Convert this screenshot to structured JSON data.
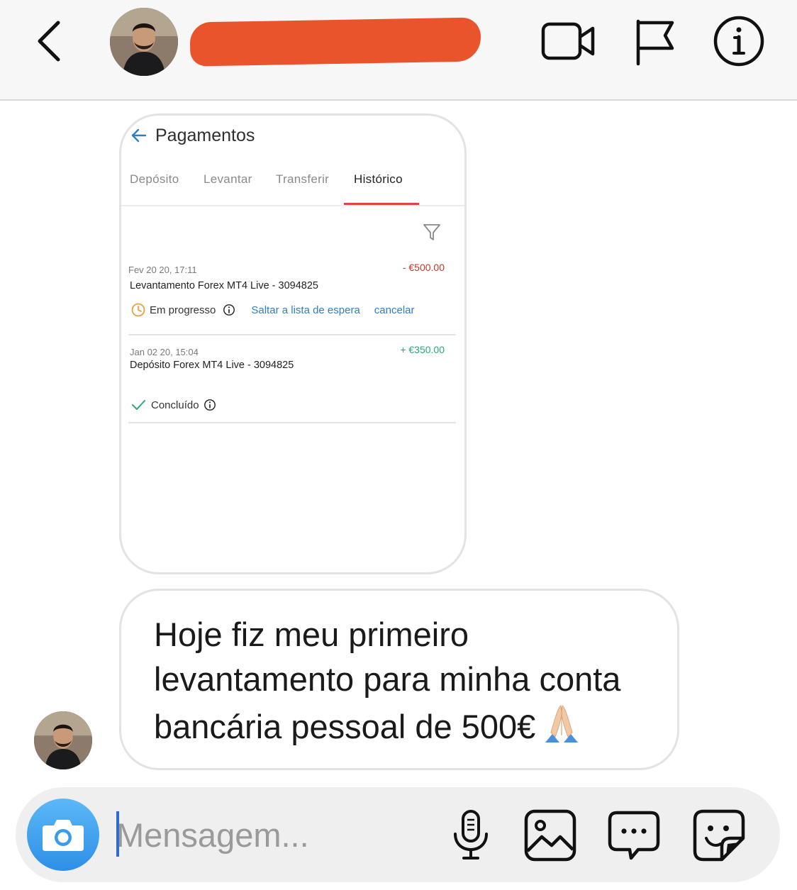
{
  "header": {
    "contact_name": "",
    "back_icon": "chevron-left-icon",
    "video_icon": "video-camera-icon",
    "flag_icon": "flag-icon",
    "info_icon": "info-icon"
  },
  "screenshot": {
    "title": "Pagamentos",
    "tabs": [
      "Depósito",
      "Levantar",
      "Transferir",
      "Histórico"
    ],
    "active_tab": "Histórico",
    "transactions": [
      {
        "date": "Fev 20 20, 17:11",
        "amount": "- €500.00",
        "description": "Levantamento Forex MT4 Live - 3094825",
        "status": "Em progresso",
        "action_1": "Saltar a lista de espera",
        "action_2": "cancelar"
      },
      {
        "date": "Jan 02 20, 15:04",
        "amount": "+ €350.00",
        "description": "Depósito Forex MT4 Live - 3094825",
        "status": "Concluído"
      }
    ]
  },
  "message": {
    "text": "Hoje fiz meu primeiro levantamento para minha conta bancária pessoal de 500€",
    "emoji": "folded-hands-emoji"
  },
  "composer": {
    "placeholder": "Mensagem..."
  },
  "colors": {
    "accent_blue": "#2f7ec1",
    "negative": "#c0392b",
    "positive": "#2aa876",
    "pending": "#e8a13a",
    "tab_underline": "#e0443a",
    "redaction": "#e9542d"
  }
}
